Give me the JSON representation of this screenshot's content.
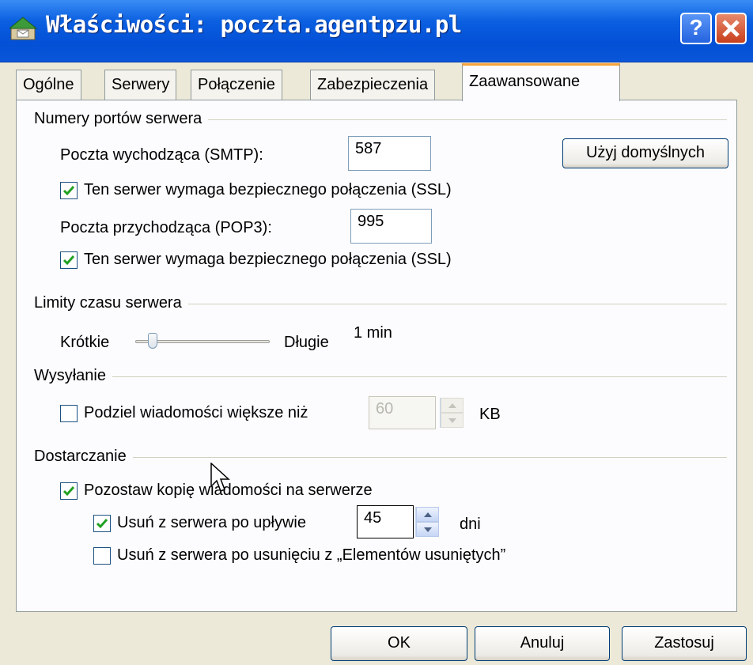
{
  "window": {
    "title": "Właściwości: poczta.agentpzu.pl",
    "help_label": "?",
    "close_label": "✕"
  },
  "tabs": [
    "Ogólne",
    "Serwery",
    "Połączenie",
    "Zabezpieczenia",
    "Zaawansowane"
  ],
  "active_tab": "Zaawansowane",
  "ports": {
    "group_label": "Numery portów serwera",
    "smtp_label": "Poczta wychodząca (SMTP):",
    "smtp_value": "587",
    "defaults_button": "Użyj domyślnych",
    "smtp_ssl_label": "Ten serwer wymaga bezpiecznego połączenia (SSL)",
    "smtp_ssl_checked": true,
    "pop3_label": "Poczta przychodząca (POP3):",
    "pop3_value": "995",
    "pop3_ssl_label": "Ten serwer wymaga bezpiecznego połączenia (SSL)",
    "pop3_ssl_checked": true
  },
  "timeouts": {
    "group_label": "Limity czasu serwera",
    "short_label": "Krótkie",
    "long_label": "Długie",
    "value_label": "1 min",
    "slider_level": 0.1
  },
  "sending": {
    "group_label": "Wysyłanie",
    "split_label": "Podziel wiadomości większe niż",
    "split_checked": false,
    "split_value": "60",
    "unit_label": "KB"
  },
  "delivery": {
    "group_label": "Dostarczanie",
    "leave_copy_label": "Pozostaw kopię wiadomości na serwerze",
    "leave_copy_checked": true,
    "remove_after_label": "Usuń z serwera po upływie",
    "remove_after_checked": true,
    "remove_after_value": "45",
    "days_label": "dni",
    "remove_deleted_label": "Usuń z serwera po usunięciu z „Elementów usuniętych”",
    "remove_deleted_checked": false
  },
  "buttons": {
    "ok": "OK",
    "cancel": "Anuluj",
    "apply": "Zastosuj"
  },
  "colors": {
    "titlebar": "#0450d6",
    "active_tab_accent": "#f5a33b",
    "checkmark": "#21a121",
    "close_button": "#c73f1c"
  }
}
